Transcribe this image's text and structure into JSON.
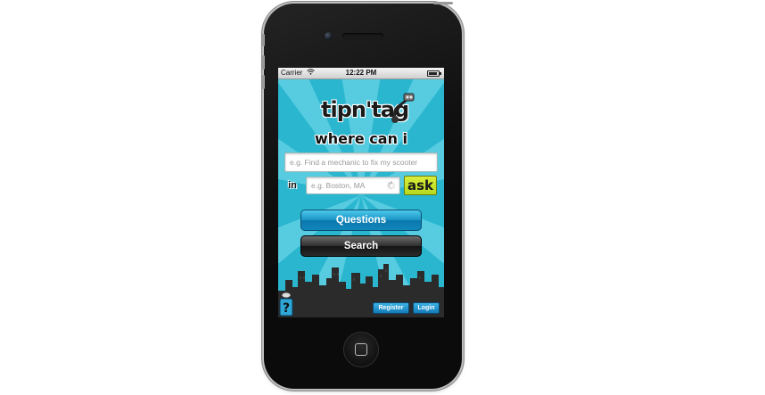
{
  "status_bar": {
    "carrier": "Carrier",
    "time": "12:22 PM",
    "icons": [
      "wifi-icon",
      "battery-icon"
    ]
  },
  "app": {
    "logo_text": "tipn'tag",
    "headline": "where can i",
    "query_placeholder": "e.g. Find a mechanic to fix my scooter",
    "linkedin_label": "in",
    "location_placeholder": "e.g. Boston, MA",
    "ask_label": "ask",
    "questions_label": "Questions",
    "search_label": "Search",
    "help_icon": "question-mark-icon",
    "register_label": "Register",
    "login_label": "Login"
  },
  "colors": {
    "sky_primary": "#2ab6cf",
    "sky_ray": "#5fd0e4",
    "ask_green": "#c5e22a",
    "questions_blue": "#1a93c6",
    "search_black": "#1a1a1a",
    "skyline": "#2b2b2b"
  }
}
